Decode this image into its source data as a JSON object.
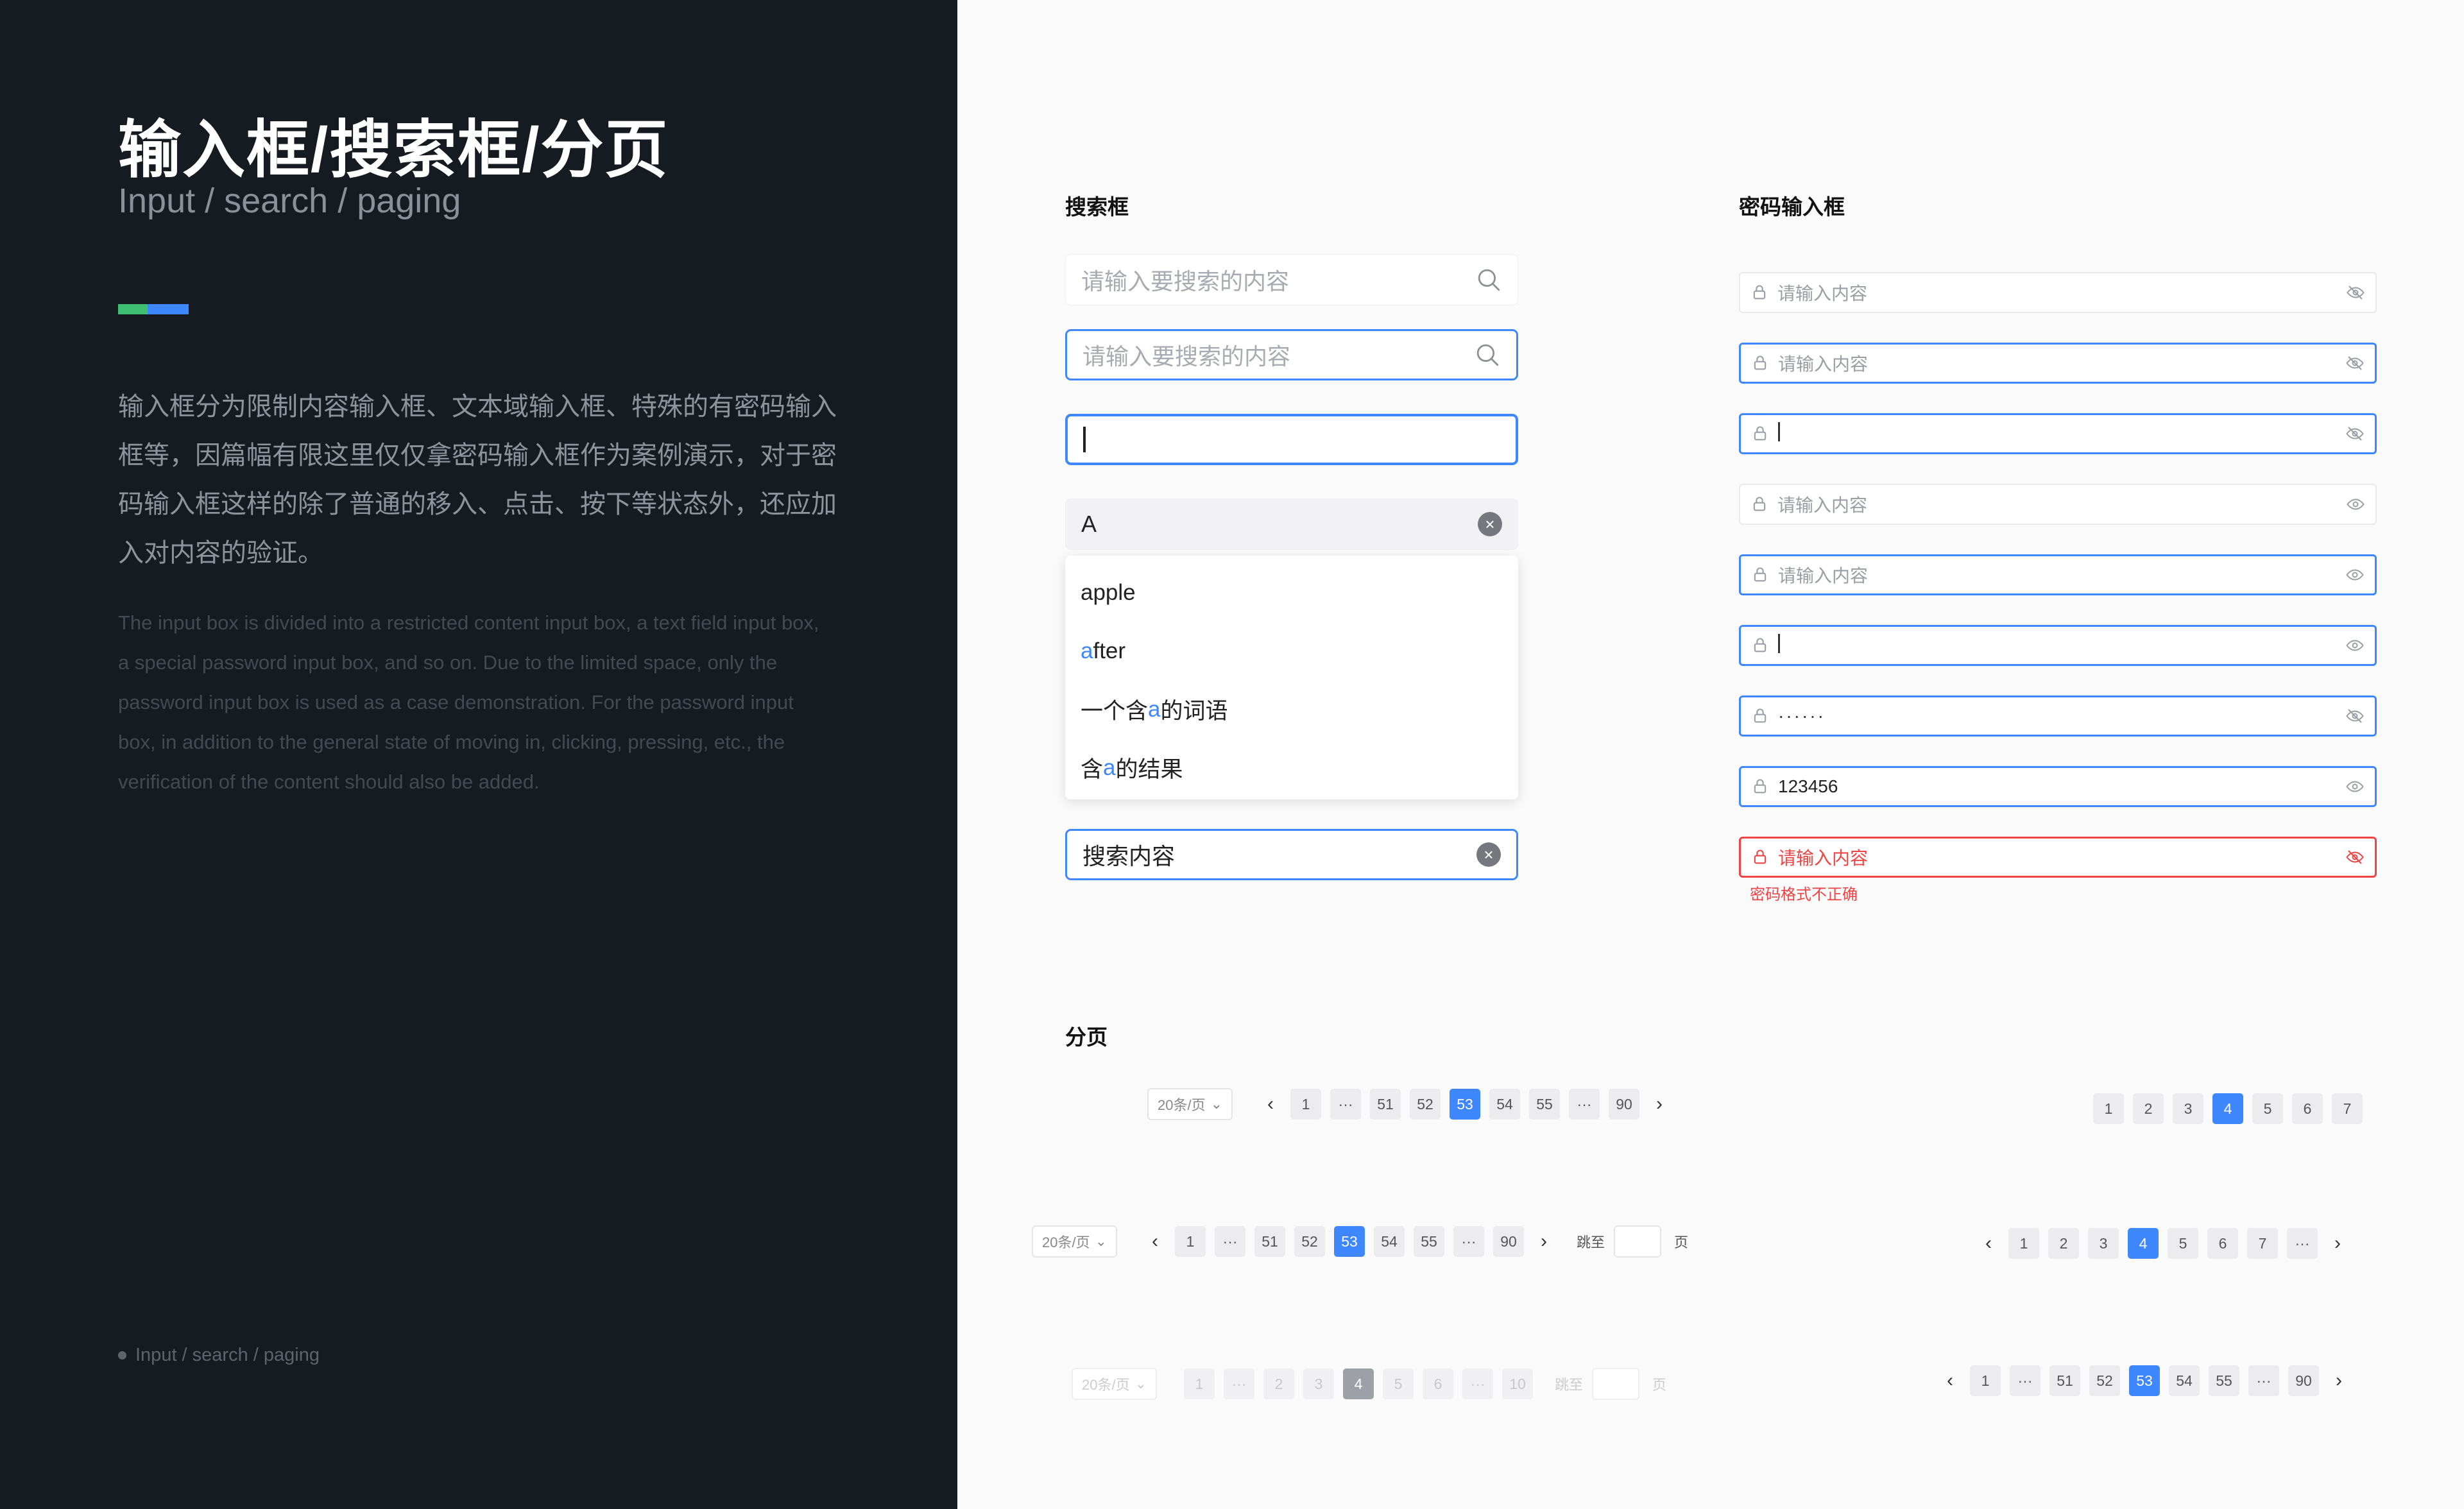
{
  "left": {
    "title": "输入框/搜索框/分页",
    "subtitle": "Input / search / paging",
    "description_cn": "输入框分为限制内容输入框、文本域输入框、特殊的有密码输入框等，因篇幅有限这里仅仅拿密码输入框作为案例演示，对于密码输入框这样的除了普通的移入、点击、按下等状态外，还应加入对内容的验证。",
    "description_en": "The input box is divided into a restricted content input box, a text field input box, a special password input box, and so on. Due to the limited space, only the password input box is used as a case demonstration. For the password input box, in addition to the general state of moving in, clicking, pressing, etc., the verification of the content should also be added.",
    "footer": "Input / search / paging",
    "colors": {
      "bg": "#161b22",
      "accent_green": "#3fbf72",
      "accent_blue": "#3f87ff"
    }
  },
  "search": {
    "heading": "搜索框",
    "placeholder": "请输入要搜索的内容",
    "typed_value": "A",
    "suggestions": [
      {
        "pre": "",
        "hl": "",
        "post": "apple"
      },
      {
        "pre": "",
        "hl": "a",
        "post": "fter"
      },
      {
        "pre": "一个含",
        "hl": "a",
        "post": "的词语"
      },
      {
        "pre": "含",
        "hl": "a",
        "post": "的结果"
      }
    ],
    "filled_value": "搜索内容"
  },
  "password": {
    "heading": "密码输入框",
    "placeholder": "请输入内容",
    "masked_value": "······",
    "visible_value": "123456",
    "error_message": "密码格式不正确",
    "colors": {
      "active": "#3f87ff",
      "error": "#ef4444"
    }
  },
  "paging": {
    "heading": "分页",
    "page_size": "20条/页",
    "jump_label": "跳至",
    "page_unit": "页",
    "ellipsis": "···",
    "prev": "‹",
    "next": "›",
    "row1": {
      "pages": [
        "1",
        "···",
        "51",
        "52",
        "53",
        "54",
        "55",
        "···",
        "90"
      ],
      "current": "53"
    },
    "row2": {
      "pages": [
        "1",
        "···",
        "51",
        "52",
        "53",
        "54",
        "55",
        "···",
        "90"
      ],
      "current": "53"
    },
    "row3_disabled": {
      "pages": [
        "1",
        "···",
        "2",
        "3",
        "4",
        "5",
        "6",
        "···",
        "10"
      ],
      "current": "4"
    },
    "simple": {
      "pages": [
        "1",
        "2",
        "3",
        "4",
        "5",
        "6",
        "7"
      ],
      "current": "4"
    },
    "simple_arrows": {
      "pages": [
        "1",
        "2",
        "3",
        "4",
        "5",
        "6",
        "7",
        "···"
      ],
      "current": "4"
    },
    "arrows_long": {
      "pages": [
        "1",
        "···",
        "51",
        "52",
        "53",
        "54",
        "55",
        "···",
        "90"
      ],
      "current": "53"
    }
  }
}
